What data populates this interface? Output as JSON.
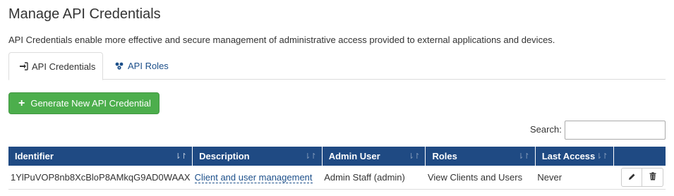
{
  "page": {
    "title": "Manage API Credentials",
    "intro": "API Credentials enable more effective and secure management of administrative access provided to external applications and devices."
  },
  "tabs": [
    {
      "label": "API Credentials",
      "icon": "sign-in-icon",
      "active": true
    },
    {
      "label": "API Roles",
      "icon": "users-cog-icon",
      "active": false
    }
  ],
  "actions": {
    "generate_label": "Generate New API Credential",
    "generate_icon": "plus-icon"
  },
  "search": {
    "label": "Search:",
    "value": ""
  },
  "table": {
    "columns": [
      "Identifier",
      "Description",
      "Admin User",
      "Roles",
      "Last Access"
    ],
    "rows": [
      {
        "identifier": "1YlPuVOP8nb8XcBloP8AMkqG9AD0WAAX",
        "description": "Client and user management",
        "admin_user": "Admin Staff (admin)",
        "roles": "View Clients and Users",
        "last_access": "Never"
      }
    ]
  },
  "colors": {
    "header_bg": "#1f4a83",
    "button_green": "#4cae4c",
    "link": "#1c4f8a"
  }
}
